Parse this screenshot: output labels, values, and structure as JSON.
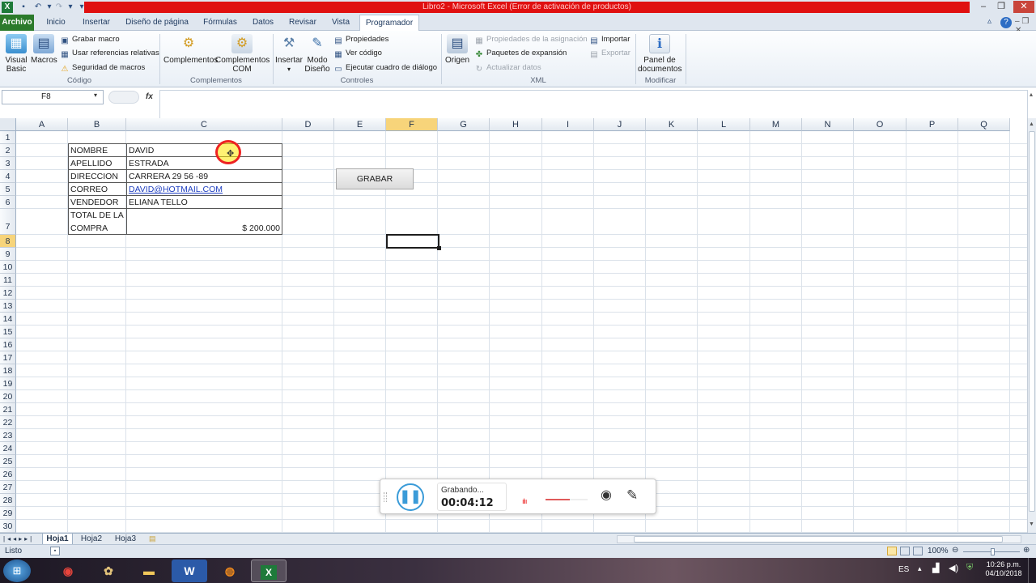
{
  "window": {
    "title": "Libro2  -  Microsoft Excel (Error de activación de productos)"
  },
  "tabs": [
    "Archivo",
    "Inicio",
    "Insertar",
    "Diseño de página",
    "Fórmulas",
    "Datos",
    "Revisar",
    "Vista",
    "Programador"
  ],
  "ribbon": {
    "codigo": {
      "label": "Código",
      "visual_basic": "Visual Basic",
      "macros": "Macros",
      "grabar_macro": "Grabar macro",
      "referencias": "Usar referencias relativas",
      "seguridad": "Seguridad de macros"
    },
    "complementos": {
      "label": "Complementos",
      "complementos": "Complementos",
      "complementos_com_1": "Complementos",
      "complementos_com_2": "COM"
    },
    "controles": {
      "label": "Controles",
      "insertar": "Insertar",
      "modo_diseno_1": "Modo",
      "modo_diseno_2": "Diseño",
      "propiedades": "Propiedades",
      "ver_codigo": "Ver código",
      "ejecutar": "Ejecutar cuadro de diálogo"
    },
    "xml": {
      "label": "XML",
      "origen": "Origen",
      "propiedades_asignacion": "Propiedades de la asignación",
      "paquetes": "Paquetes de expansión",
      "actualizar": "Actualizar datos",
      "importar": "Importar",
      "exportar": "Exportar"
    },
    "modificar": {
      "label": "Modificar",
      "panel_1": "Panel de",
      "panel_2": "documentos"
    }
  },
  "formula_bar": {
    "name_box": "F8",
    "fx": "fx",
    "formula": ""
  },
  "columns": [
    "A",
    "B",
    "C",
    "D",
    "E",
    "F",
    "G",
    "H",
    "I",
    "J",
    "K",
    "L",
    "M",
    "N",
    "O",
    "P",
    "Q"
  ],
  "rows": [
    "1",
    "2",
    "3",
    "4",
    "5",
    "6",
    "7",
    "8",
    "9",
    "10",
    "11",
    "12",
    "13",
    "14",
    "15",
    "16",
    "17",
    "18",
    "19",
    "20",
    "21",
    "22",
    "23",
    "24",
    "25",
    "26",
    "27",
    "28",
    "29",
    "30"
  ],
  "table": {
    "rows": [
      {
        "label": "NOMBRE",
        "value": "DAVID"
      },
      {
        "label": "APELLIDO",
        "value": "ESTRADA"
      },
      {
        "label": "DIRECCION",
        "value": "CARRERA 29 56 -89"
      },
      {
        "label": "CORREO",
        "value": "DAVID@HOTMAIL.COM"
      },
      {
        "label": "VENDEDOR",
        "value": "ELIANA TELLO"
      }
    ],
    "total_label_1": "TOTAL DE LA",
    "total_label_2": "COMPRA",
    "total_value": "$ 200.000"
  },
  "grabar_button": "GRABAR",
  "recorder": {
    "status": "Grabando...",
    "time": "00:04:12"
  },
  "sheets": [
    "Hoja1",
    "Hoja2",
    "Hoja3"
  ],
  "status": {
    "ready": "Listo",
    "zoom": "100%"
  },
  "taskbar": {
    "language": "ES",
    "time": "10:26 p.m.",
    "date": "04/10/2018"
  },
  "colors": {
    "title_red": "#e01010",
    "archivo_green": "#2b7a2b",
    "selected_header": "#f7d47a",
    "link_blue": "#1f3fc0",
    "record_blue": "#3a9bd8"
  }
}
